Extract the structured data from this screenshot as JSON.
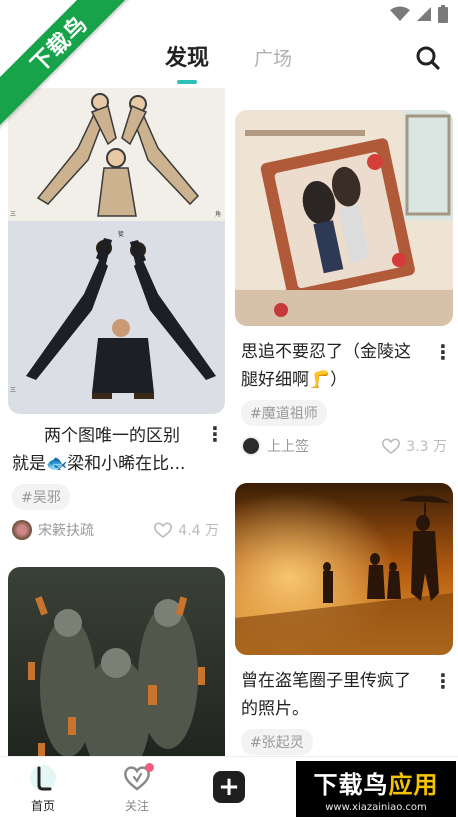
{
  "ribbon": {
    "text": "下载鸟"
  },
  "header": {
    "tab_discover": "发现",
    "tab_square": "广场"
  },
  "colors": {
    "accent": "#2bc1b4",
    "ribbon": "#17a34a",
    "watermark_yellow": "#f5c400"
  },
  "feed": {
    "left": [
      {
        "caption_line1": "两个图唯一的区别",
        "caption_line2": "就是🐟梁和小晞在比...",
        "tag": "#吴邪",
        "author": "宋簌扶疏",
        "likes": "4.4 万"
      }
    ],
    "right": [
      {
        "caption_line1": "思追不要忍了（金陵这",
        "caption_line2": "腿好细啊🦵）",
        "tag": "#魔道祖师",
        "author": "上上签",
        "likes": "3.3 万"
      },
      {
        "caption_line1": "曾在盗笔圈子里传疯了",
        "caption_line2": "的照片。",
        "tag": "#张起灵"
      }
    ]
  },
  "tabbar": {
    "home": "首页",
    "follow": "关注"
  },
  "watermark": {
    "main_white": "下载鸟",
    "main_yellow": "应用",
    "url": "www.xiazainiao.com"
  }
}
